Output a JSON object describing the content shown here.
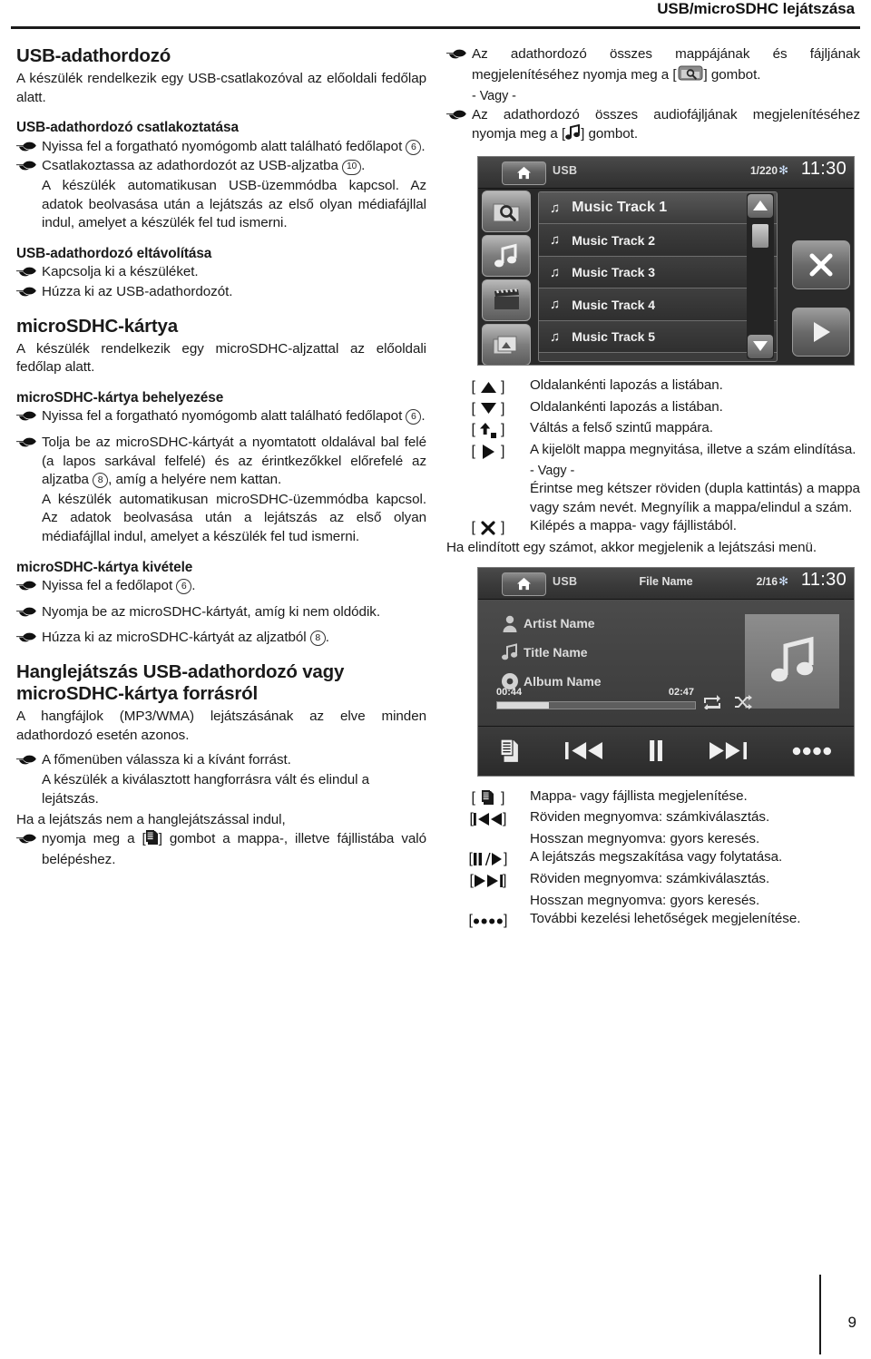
{
  "header": {
    "title": "USB/microSDHC lejátszása"
  },
  "footer": {
    "page_number": "9"
  },
  "left_column": {
    "section1": {
      "heading": "USB-adathordozó",
      "intro": "A készülék rendelkezik egy USB-csatlakozóval az előoldali fedőlap alatt.",
      "sub1_heading": "USB-adathordozó csatlakoztatása",
      "sub1_b1_a": "Nyissa fel a forgatható nyomógomb alatt található fedőlapot",
      "sub1_b1_num": "6",
      "sub1_b1_b": ".",
      "sub1_b2_a": "Csatlakoztassa az adathordozót az USB-aljzatba",
      "sub1_b2_num": "10",
      "sub1_b2_b": ".",
      "sub1_note": "A készülék automatikusan USB-üzemmódba kapcsol. Az adatok beolvasása után a lejátszás az első olyan médiafájllal indul, amelyet a készülék fel tud ismerni.",
      "sub2_heading": "USB-adathordozó eltávolítása",
      "sub2_b1": "Kapcsolja ki a készüléket.",
      "sub2_b2": "Húzza ki az USB-adathordozót."
    },
    "section2": {
      "heading": "microSDHC-kártya",
      "intro": "A készülék rendelkezik egy microSDHC-aljzattal az előoldali fedőlap alatt.",
      "sub1_heading": "microSDHC-kártya behelyezése",
      "sub1_b1_a": "Nyissa fel a forgatható nyomógomb alatt található fedőlapot",
      "sub1_b1_num": "6",
      "sub1_b1_b": ".",
      "sub1_b2_a": "Tolja be az microSDHC-kártyát a nyomtatott oldalával bal felé (a lapos sarkával felfelé) és az érintkezőkkel előrefelé az aljzatba",
      "sub1_b2_num": "8",
      "sub1_b2_b": ", amíg a helyére nem kattan.",
      "sub1_note": "A készülék automatikusan microSDHC-üzemmódba kapcsol. Az adatok beolvasása után a lejátszás az első olyan médiafájllal indul, amelyet a készülék fel tud ismerni.",
      "sub2_heading": "microSDHC-kártya kivétele",
      "sub2_b1_a": "Nyissa fel a fedőlapot",
      "sub2_b1_num": "6",
      "sub2_b1_b": ".",
      "sub2_b2": "Nyomja be az microSDHC-kártyát, amíg ki nem oldódik.",
      "sub2_b3_a": "Húzza ki az microSDHC-kártyát az aljzatból",
      "sub2_b3_num": "8",
      "sub2_b3_b": "."
    },
    "section3": {
      "heading_line1": "Hanglejátszás USB-adathordozó vagy",
      "heading_line2": "microSDHC-kártya forrásról",
      "intro": "A hangfájlok (MP3/WMA) lejátszásának az elve minden adathordozó esetén azonos.",
      "b1": "A főmenüben válassza ki a kívánt forrást.",
      "note1": "A készülék a kiválasztott hangforrásra vált és elindul a lejátszás.",
      "line2": "Ha a lejátszás nem a hanglejátszással indul,",
      "b2_a": "nyomja meg a [",
      "b2_icon": "list-icon",
      "b2_b": "] gombot a mappa-, illetve fájllistába való belépéshez."
    }
  },
  "right_column": {
    "b1_a": "Az adathordozó összes mappájának és fájljának megjelenítéséhez nyomja meg a [",
    "b1_icon": "folder-search-icon",
    "b1_b": "] gombot.",
    "or1": "- Vagy -",
    "b2_a": "Az adathordozó összes audiofájljának megjelenítéséhez nyomja meg a [",
    "b2_icon": "music-note-icon",
    "b2_b": "] gombot.",
    "screenshot_list": {
      "source": "USB",
      "track_count": "1/220",
      "clock": "11:30",
      "sidebar_icons": [
        "folder-search-icon",
        "music-note-icon",
        "film-clapper-icon",
        "photos-icon"
      ],
      "rows": [
        "Music Track 1",
        "Music Track 2",
        "Music Track 3",
        "Music Track 4",
        "Music Track 5"
      ],
      "selected_row": 0,
      "right_buttons": [
        "close-icon",
        "play-icon"
      ],
      "scroll_buttons": [
        "up-arrow-icon",
        "down-arrow-icon"
      ]
    },
    "legend1": [
      {
        "icon": "up-triangle-icon",
        "desc": "Oldalankénti lapozás a listában."
      },
      {
        "icon": "down-triangle-icon",
        "desc": "Oldalankénti lapozás a listában."
      },
      {
        "icon": "up-level-icon",
        "desc": "Váltás a felső szintű mappára."
      },
      {
        "icon": "right-triangle-icon",
        "desc": "A kijelölt mappa megnyitása, illetve a szám elindítása."
      }
    ],
    "legend1_or": "- Vagy -",
    "legend1_note": "Érintse meg kétszer röviden (dupla kattintás) a mappa vagy szám nevét. Megnyílik a mappa/elindul a szám.",
    "legend1_last": {
      "icon": "close-x-icon",
      "desc": "Kilépés a mappa- vagy fájllistából."
    },
    "after_legend1": "Ha elindított egy számot, akkor megjelenik a lejátszási menü.",
    "screenshot_play": {
      "source": "USB",
      "center_label": "File Name",
      "track_count": "2/16",
      "clock": "11:30",
      "artist": "Artist Name",
      "title": "Title Name",
      "album": "Album Name",
      "time_elapsed": "00:44",
      "time_total": "02:47",
      "progress_percent": 26,
      "mode_icons": [
        "repeat-icon",
        "shuffle-icon"
      ],
      "controls": [
        "list-icon",
        "previous-icon",
        "pause-icon",
        "next-icon",
        "more-icon"
      ]
    },
    "legend2": [
      {
        "icon": "list-icon",
        "desc": "Mappa- vagy fájllista megjelenítése.",
        "desc2": ""
      },
      {
        "icon": "previous-icon",
        "desc": "Röviden megnyomva: számkiválasztás.",
        "desc2": "Hosszan megnyomva: gyors keresés."
      },
      {
        "icon": "pause-play-icon",
        "desc": "A lejátszás megszakítása vagy folytatása.",
        "desc2": ""
      },
      {
        "icon": "next-icon",
        "desc": "Röviden megnyomva: számkiválasztás.",
        "desc2": "Hosszan megnyomva: gyors keresés."
      },
      {
        "icon": "more-icon",
        "desc": "További kezelési lehetőségek megjelenítése.",
        "desc2": ""
      }
    ]
  }
}
